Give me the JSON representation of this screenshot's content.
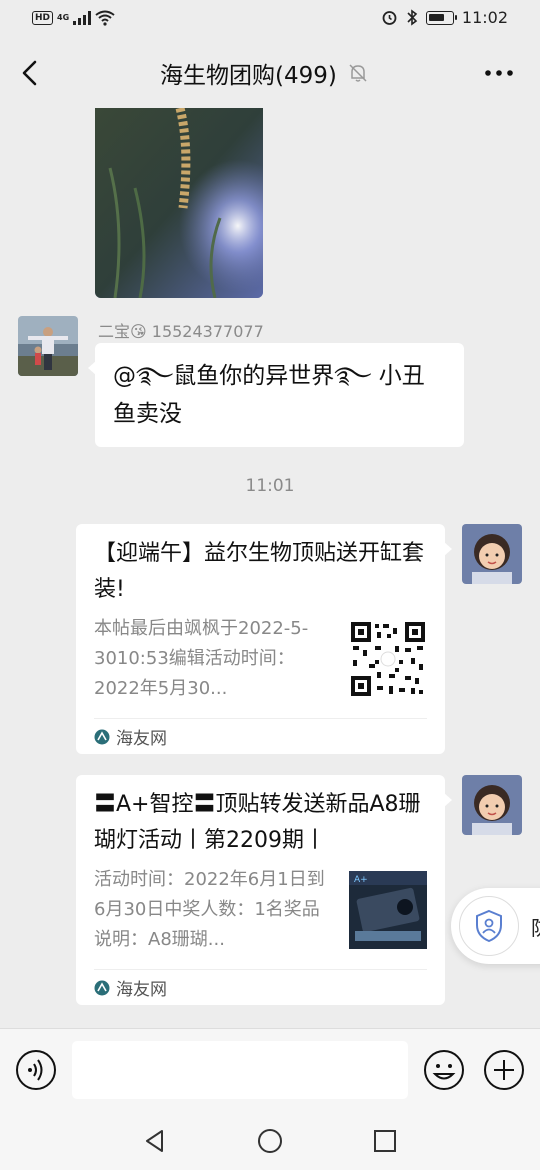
{
  "status_bar": {
    "hd_badge": "HD",
    "network": "4G",
    "time": "11:02",
    "battery_level": 0.7
  },
  "header": {
    "title": "海生物团购(499)",
    "back_icon": "back-arrow-icon",
    "mute_icon": "bell-muted-icon",
    "more_icon": "more-dots-icon"
  },
  "messages": {
    "text_message": {
      "sender_name": "二宝😘 15524377077",
      "text": "@࿐鼠鱼你的异世界࿐ 小丑鱼卖没"
    },
    "timestamp": "11:01",
    "link_cards": [
      {
        "title": "【迎端午】益尔生物顶贴送开缸套装!",
        "description": "本帖最后由飒枫于2022-5-3010:53编辑活动时间：2022年5月30...",
        "source": "海友网",
        "thumb_icon": "qr-code-icon"
      },
      {
        "title": "〓A+智控〓顶贴转发送新品A8珊 瑚灯活动丨第2209期丨",
        "description": "活动时间：2022年6月1日到6月30日中奖人数：1名奖品说明：A8珊瑚...",
        "source": "海友网",
        "thumb_icon": "product-image-icon"
      }
    ]
  },
  "floating_button": {
    "label": "防",
    "icon": "shield-icon"
  },
  "input_bar": {
    "voice_icon": "voice-icon",
    "emoji_icon": "emoji-icon",
    "plus_icon": "plus-icon"
  },
  "system_nav": {
    "back": "triangle-back-icon",
    "home": "circle-home-icon",
    "recents": "square-recents-icon"
  },
  "colors": {
    "background": "#ededed",
    "bubble": "#ffffff",
    "meta_text": "#8a8a8a"
  }
}
